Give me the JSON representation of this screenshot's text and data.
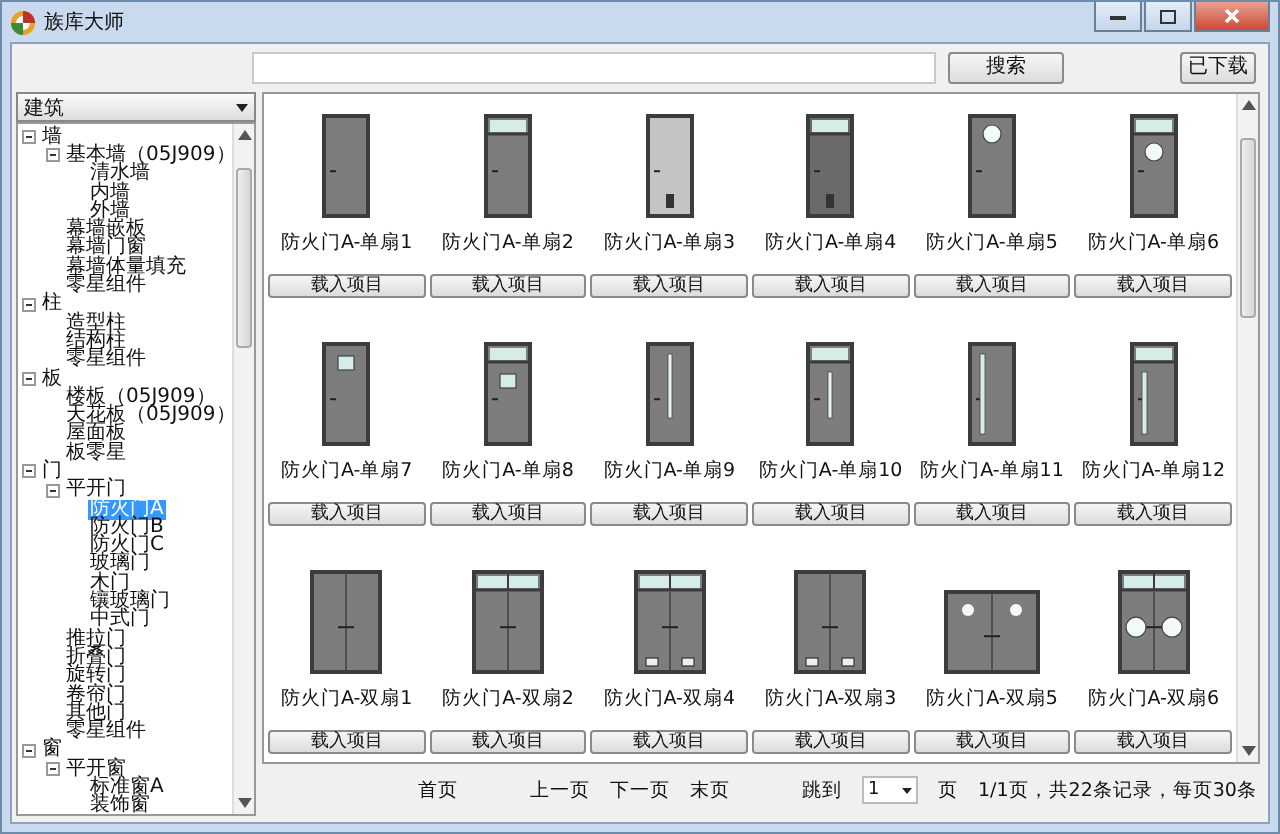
{
  "window": {
    "title": "族库大师"
  },
  "toolbar": {
    "search_button": "搜索",
    "downloaded_button": "已下载"
  },
  "category_dropdown": {
    "value": "建筑"
  },
  "tree": [
    {
      "label": "墙",
      "expanded": true,
      "selected": false,
      "children": [
        {
          "label": "基本墙（05J909）",
          "expanded": true,
          "selected": false,
          "children": [
            {
              "label": "清水墙",
              "selected": false
            },
            {
              "label": "内墙",
              "selected": false
            },
            {
              "label": "外墙",
              "selected": false
            }
          ]
        },
        {
          "label": "幕墙嵌板",
          "selected": false
        },
        {
          "label": "幕墙门窗",
          "selected": false
        },
        {
          "label": "幕墙体量填充",
          "selected": false
        },
        {
          "label": "零星组件",
          "selected": false
        }
      ]
    },
    {
      "label": "柱",
      "expanded": true,
      "selected": false,
      "children": [
        {
          "label": "造型柱",
          "selected": false
        },
        {
          "label": "结构柱",
          "selected": false
        },
        {
          "label": "零星组件",
          "selected": false
        }
      ]
    },
    {
      "label": "板",
      "expanded": true,
      "selected": false,
      "children": [
        {
          "label": "楼板（05J909）",
          "selected": false
        },
        {
          "label": "天花板（05J909）",
          "selected": false
        },
        {
          "label": "屋面板",
          "selected": false
        },
        {
          "label": "板零星",
          "selected": false
        }
      ]
    },
    {
      "label": "门",
      "expanded": true,
      "selected": false,
      "children": [
        {
          "label": "平开门",
          "expanded": true,
          "selected": false,
          "children": [
            {
              "label": "防火门A",
              "selected": true
            },
            {
              "label": "防火门B",
              "selected": false
            },
            {
              "label": "防火门C",
              "selected": false
            },
            {
              "label": "玻璃门",
              "selected": false
            },
            {
              "label": "木门",
              "selected": false
            },
            {
              "label": "镶玻璃门",
              "selected": false
            },
            {
              "label": "中式门",
              "selected": false
            }
          ]
        },
        {
          "label": "推拉门",
          "selected": false
        },
        {
          "label": "折叠门",
          "selected": false
        },
        {
          "label": "旋转门",
          "selected": false
        },
        {
          "label": "卷帘门",
          "selected": false
        },
        {
          "label": "其他门",
          "selected": false
        },
        {
          "label": "零星组件",
          "selected": false
        }
      ]
    },
    {
      "label": "窗",
      "expanded": true,
      "selected": false,
      "children": [
        {
          "label": "平开窗",
          "expanded": true,
          "selected": false,
          "children": [
            {
              "label": "标准窗A",
              "selected": false
            },
            {
              "label": "装饰窗",
              "selected": false
            }
          ]
        }
      ]
    }
  ],
  "items": [
    {
      "name": "防火门A-单扇1",
      "kind": "single-plain",
      "button": "载入项目"
    },
    {
      "name": "防火门A-单扇2",
      "kind": "single-transom",
      "button": "载入项目"
    },
    {
      "name": "防火门A-单扇3",
      "kind": "single-light-vent",
      "button": "载入项目"
    },
    {
      "name": "防火门A-单扇4",
      "kind": "single-dark-transom-vent",
      "button": "载入项目"
    },
    {
      "name": "防火门A-单扇5",
      "kind": "single-porthole",
      "button": "载入项目"
    },
    {
      "name": "防火门A-单扇6",
      "kind": "single-transom-porthole",
      "button": "载入项目"
    },
    {
      "name": "防火门A-单扇7",
      "kind": "single-square-window",
      "button": "载入项目"
    },
    {
      "name": "防火门A-单扇8",
      "kind": "single-transom-square-window",
      "button": "载入项目"
    },
    {
      "name": "防火门A-单扇9",
      "kind": "single-center-strip",
      "button": "载入项目"
    },
    {
      "name": "防火门A-单扇10",
      "kind": "single-transom-center-strip",
      "button": "载入项目"
    },
    {
      "name": "防火门A-单扇11",
      "kind": "single-edge-strip",
      "button": "载入项目"
    },
    {
      "name": "防火门A-单扇12",
      "kind": "single-transom-edge-strip",
      "button": "载入项目"
    },
    {
      "name": "防火门A-双扇1",
      "kind": "double-plain",
      "button": "载入项目"
    },
    {
      "name": "防火门A-双扇2",
      "kind": "double-transom",
      "button": "载入项目"
    },
    {
      "name": "防火门A-双扇4",
      "kind": "double-transom-vents",
      "button": "载入项目"
    },
    {
      "name": "防火门A-双扇3",
      "kind": "double-vents",
      "button": "载入项目"
    },
    {
      "name": "防火门A-双扇5",
      "kind": "double-wide-portholes",
      "button": "载入项目"
    },
    {
      "name": "防火门A-双扇6",
      "kind": "double-transom-portholes",
      "button": "载入项目"
    }
  ],
  "pager": {
    "first": "首页",
    "prev": "上一页",
    "next": "下一页",
    "last": "末页",
    "jump_label": "跳到",
    "page_select": "1",
    "page_unit": "页",
    "status": "1/1页，共22条记录，每页30条"
  }
}
